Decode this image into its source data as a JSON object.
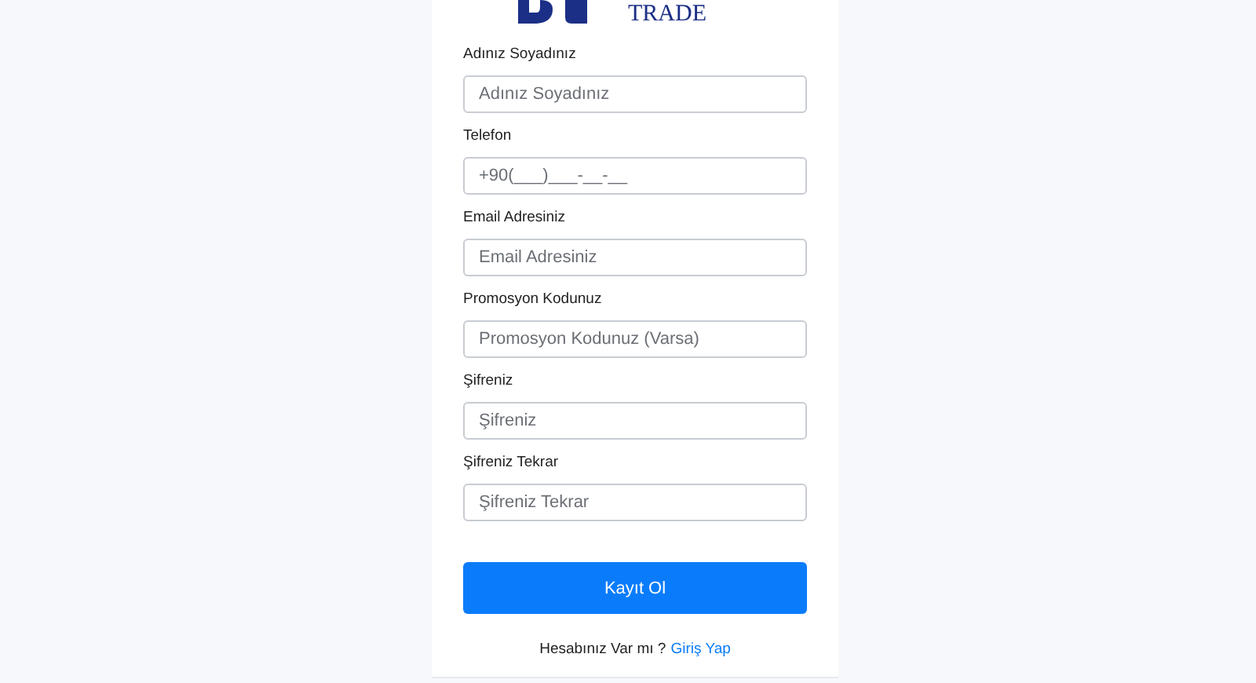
{
  "logo": {
    "text": "TRADE"
  },
  "fields": [
    {
      "label": "Adınız Soyadınız",
      "placeholder": "Adınız Soyadınız"
    },
    {
      "label": "Telefon",
      "placeholder": "+90(___)___-__-__"
    },
    {
      "label": "Email Adresiniz",
      "placeholder": "Email Adresiniz"
    },
    {
      "label": "Promosyon Kodunuz",
      "placeholder": "Promosyon Kodunuz (Varsa)"
    },
    {
      "label": "Şifreniz",
      "placeholder": "Şifreniz"
    },
    {
      "label": "Şifreniz Tekrar",
      "placeholder": "Şifreniz Tekrar"
    }
  ],
  "submit_button": "Kayıt Ol",
  "footer": {
    "text": "Hesabınız Var mı ?",
    "link": "Giriş Yap"
  }
}
